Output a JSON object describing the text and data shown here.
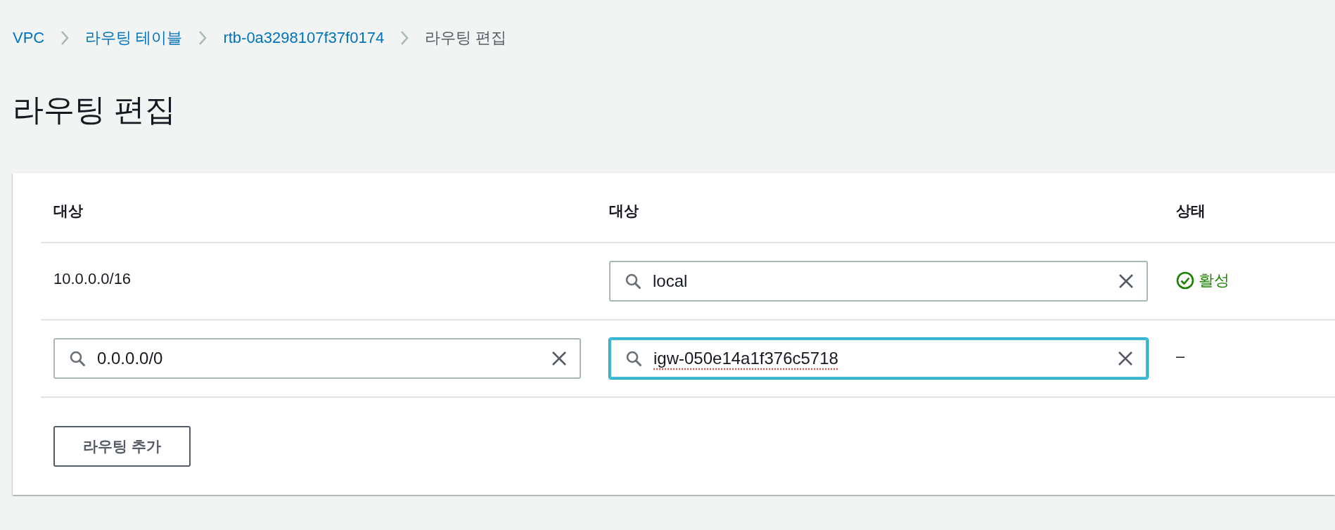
{
  "breadcrumbs": [
    {
      "label": "VPC",
      "current": false
    },
    {
      "label": "라우팅 테이블",
      "current": false
    },
    {
      "label": "rtb-0a3298107f37f0174",
      "current": false
    },
    {
      "label": "라우팅 편집",
      "current": true
    }
  ],
  "title": "라우팅 편집",
  "table": {
    "columns": [
      "대상",
      "대상",
      "상태"
    ],
    "rows": [
      {
        "cells": [
          {
            "kind": "text",
            "text": "10.0.0.0/16"
          },
          {
            "kind": "field",
            "value": "local",
            "focused": false
          },
          {
            "kind": "status",
            "text": "활성",
            "color": "#1d8102"
          }
        ]
      },
      {
        "cells": [
          {
            "kind": "field",
            "value": "0.0.0.0/0",
            "focused": false
          },
          {
            "kind": "field",
            "value": "igw-050e14a1f376c5718",
            "focused": true
          },
          {
            "kind": "text",
            "text": "–"
          }
        ]
      }
    ]
  },
  "add_button": "라우팅 추가"
}
